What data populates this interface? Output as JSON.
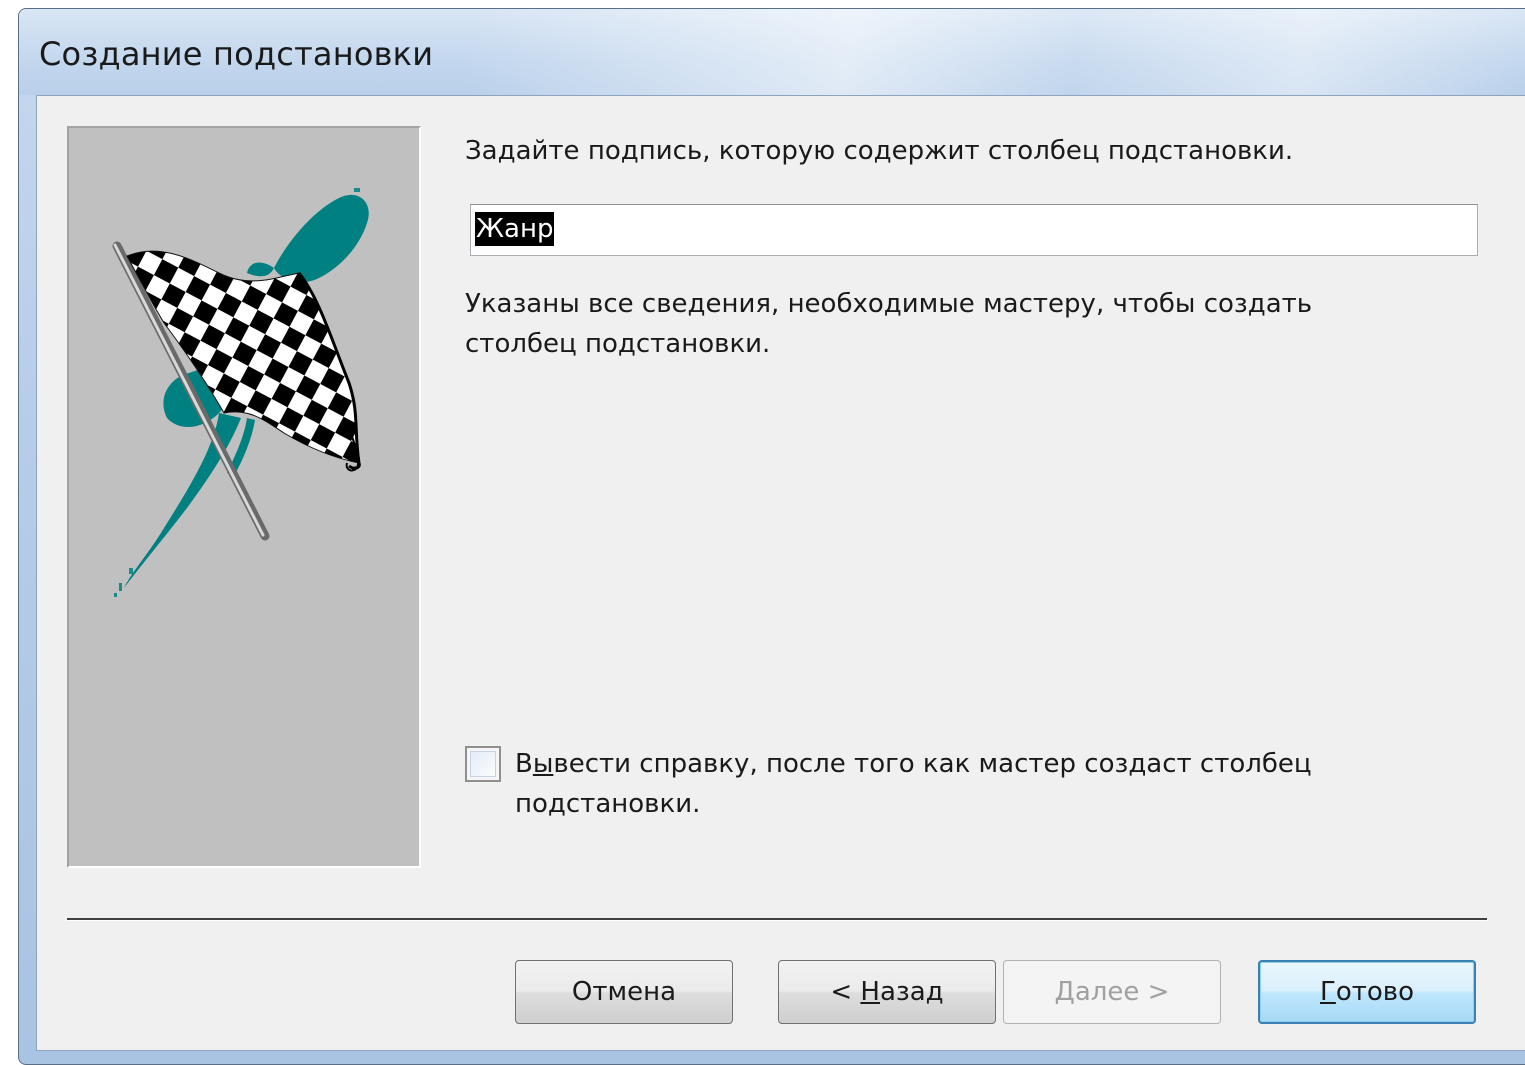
{
  "window": {
    "title": "Создание подстановки"
  },
  "wizard": {
    "prompt": "Задайте подпись, которую содержит столбец подстановки.",
    "caption_value": "Жанр",
    "info_line1": "Указаны все сведения, необходимые мастеру, чтобы создать",
    "info_line2": "столбец подстановки.",
    "help_checkbox": {
      "checked": false,
      "label_pre": "В",
      "label_access_key": "ы",
      "label_post": "вести справку, после того как мастер создаст столбец",
      "label_line2": "подстановки."
    }
  },
  "buttons": {
    "cancel": "Отмена",
    "back_prefix": "< ",
    "back_key": "Н",
    "back_rest": "азад",
    "next_key": "Д",
    "next_rest": "алее >",
    "finish_key": "Г",
    "finish_rest": "отово"
  },
  "icons": {
    "wizard_image": "checkered-flag-icon"
  },
  "colors": {
    "client_bg": "#f0f0f0",
    "image_panel_bg": "#c0c0c0",
    "brush_teal": "#008080"
  }
}
